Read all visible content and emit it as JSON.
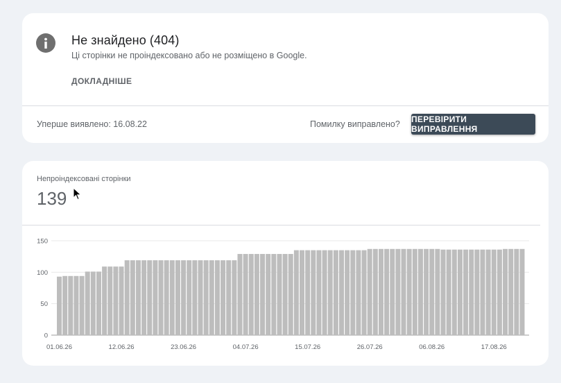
{
  "issue": {
    "title": "Не знайдено (404)",
    "description": "Ці сторінки не проіндексовано або не розміщено в Google.",
    "learn_more": "ДОКЛАДНІШЕ",
    "first_detected": "Уперше виявлено: 16.08.22",
    "fixed_question": "Помилку виправлено?",
    "validate_button": "ПЕРЕВІРИТИ ВИПРАВЛЕННЯ",
    "icon": "info-icon"
  },
  "metric": {
    "label": "Непроіндексовані сторінки",
    "value": "139"
  },
  "colors": {
    "background": "#eff2f6",
    "bar": "#bdbdbd",
    "button": "#3c4a57",
    "icon": "#6f6f6f"
  },
  "chart_data": {
    "type": "bar",
    "ylim": [
      0,
      150
    ],
    "yticks": [
      0,
      50,
      100,
      150
    ],
    "xtick_labels": [
      "01.06.26",
      "12.06.26",
      "23.06.26",
      "04.07.26",
      "15.07.26",
      "26.07.26",
      "06.08.26",
      "17.08.26"
    ],
    "xtick_indices": [
      0,
      11,
      22,
      33,
      44,
      55,
      66,
      77
    ],
    "grid": true,
    "values": [
      93,
      94,
      94,
      94,
      94,
      101,
      101,
      101,
      109,
      109,
      109,
      109,
      119,
      119,
      119,
      119,
      119,
      119,
      119,
      119,
      119,
      119,
      119,
      119,
      119,
      119,
      119,
      119,
      119,
      119,
      119,
      119,
      129,
      129,
      129,
      129,
      129,
      129,
      129,
      129,
      129,
      129,
      135,
      135,
      135,
      135,
      135,
      135,
      135,
      135,
      135,
      135,
      135,
      135,
      135,
      137,
      137,
      137,
      137,
      137,
      137,
      137,
      137,
      137,
      137,
      137,
      137,
      137,
      136,
      136,
      136,
      136,
      136,
      136,
      136,
      136,
      136,
      136,
      136,
      137,
      137,
      137,
      137
    ]
  }
}
